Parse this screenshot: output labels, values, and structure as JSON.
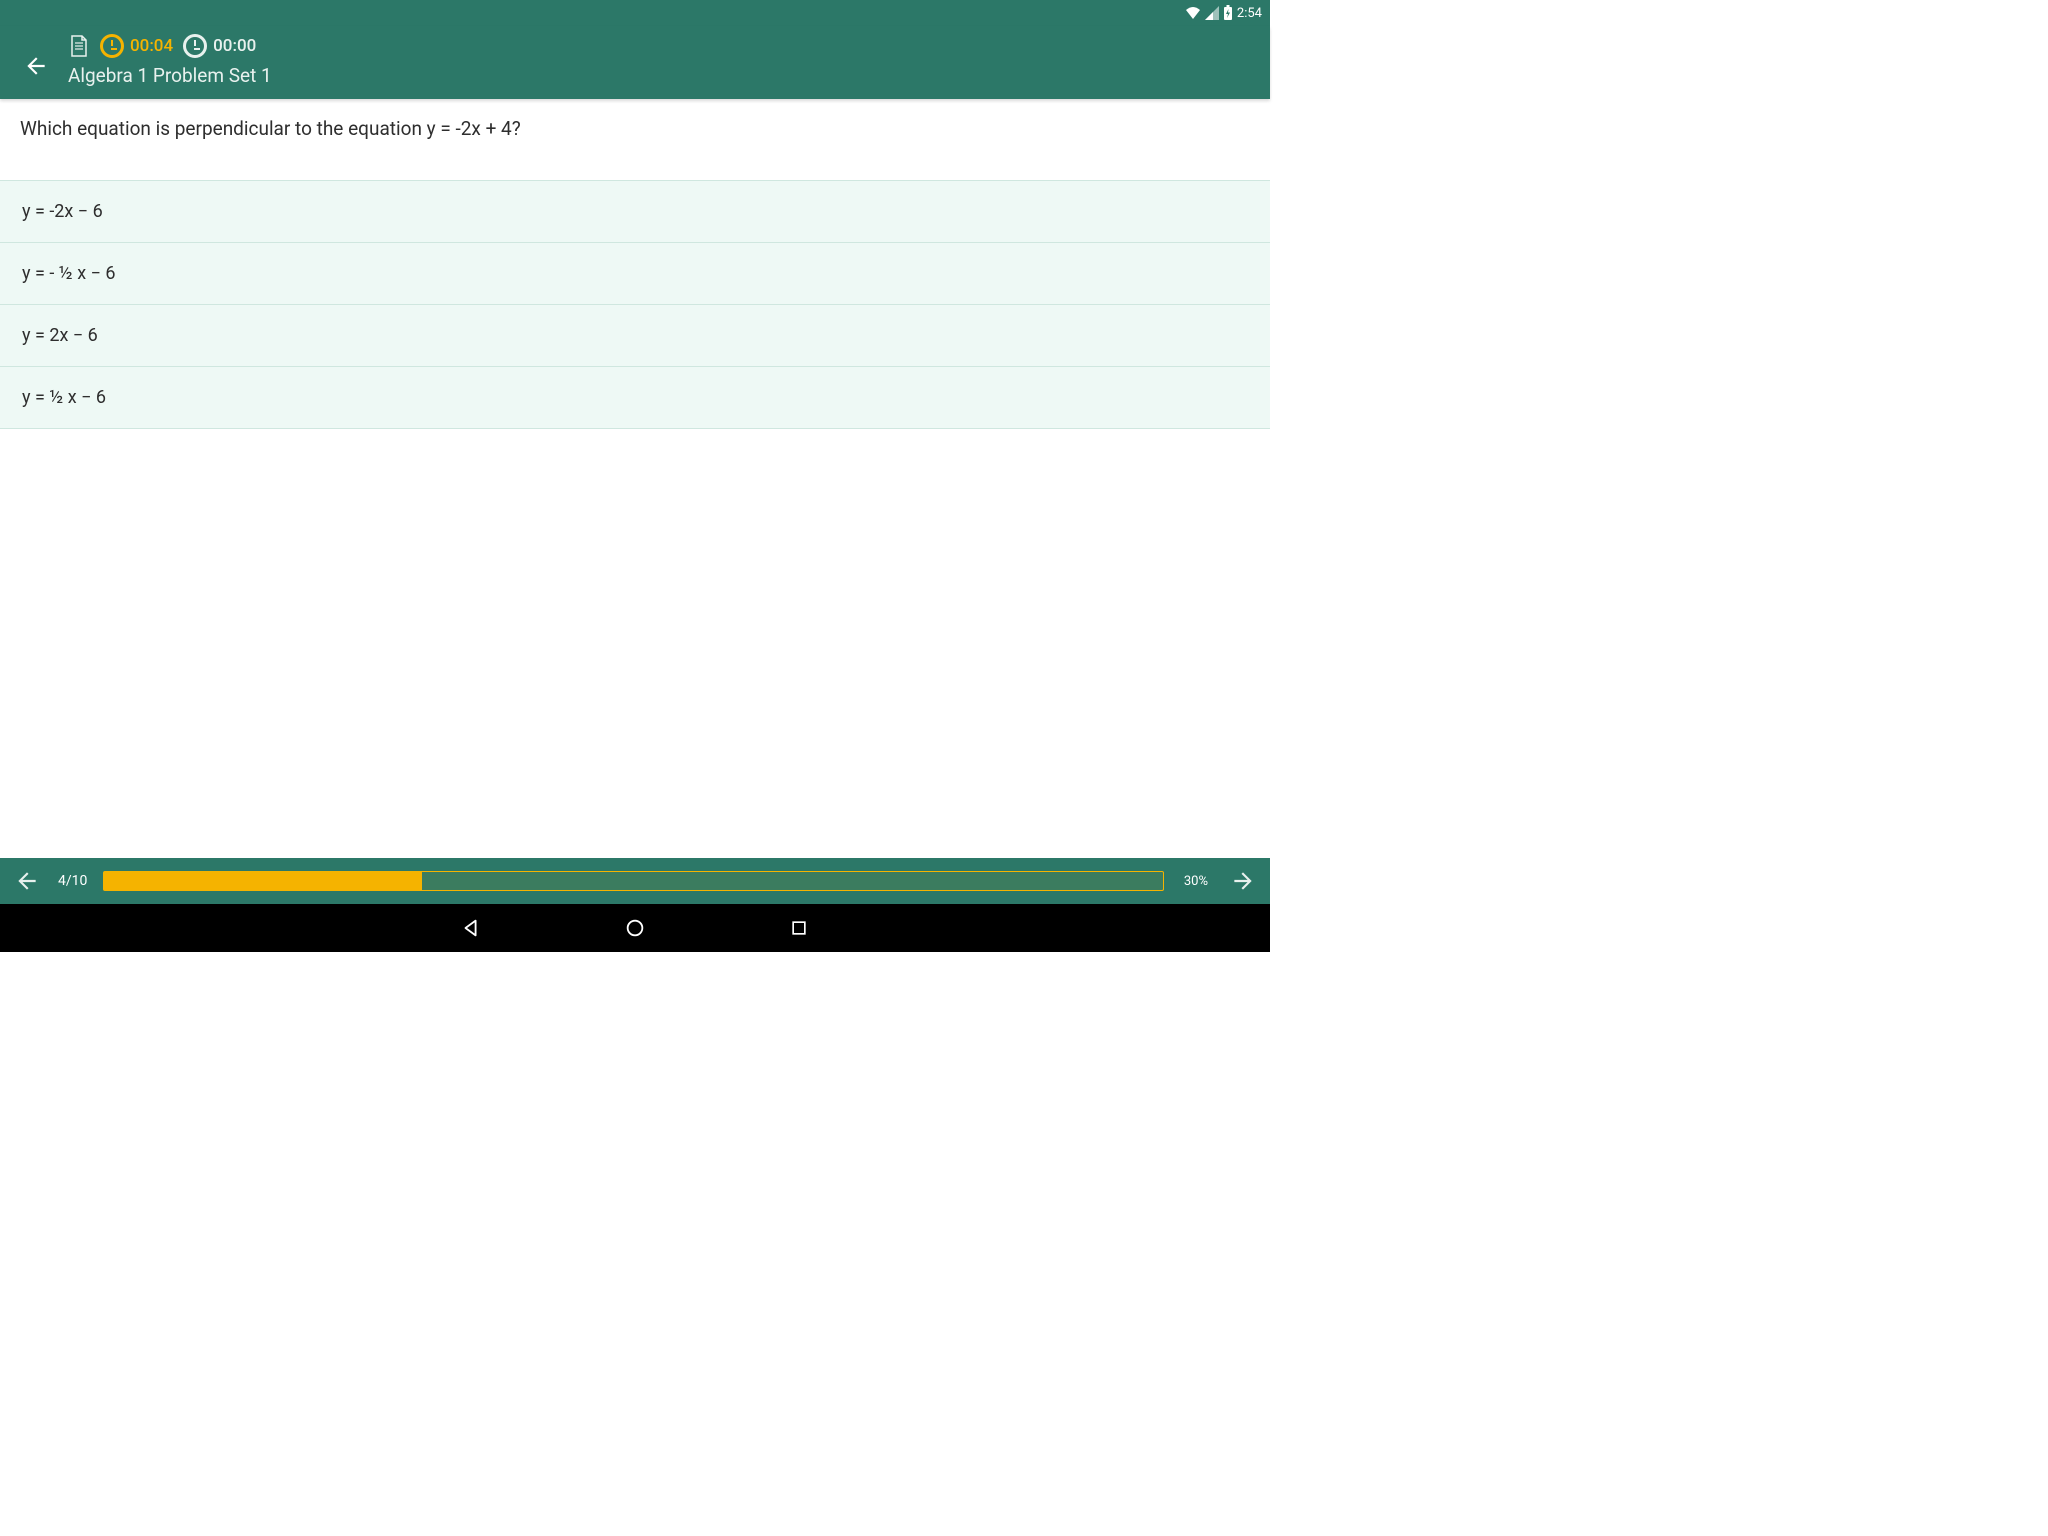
{
  "status": {
    "time": "2:54"
  },
  "appbar": {
    "timer_active": "00:04",
    "timer_total": "00:00",
    "title": "Algebra 1 Problem Set 1"
  },
  "question": {
    "text": "Which equation is perpendicular to the equation y = -2x + 4?"
  },
  "options": [
    {
      "text": "y = -2x − 6"
    },
    {
      "text": "y = - ½ x − 6"
    },
    {
      "text": "y = 2x − 6"
    },
    {
      "text": "y = ½ x − 6"
    }
  ],
  "progress": {
    "counter": "4/10",
    "percent_label": "30%",
    "percent_value": 30
  }
}
